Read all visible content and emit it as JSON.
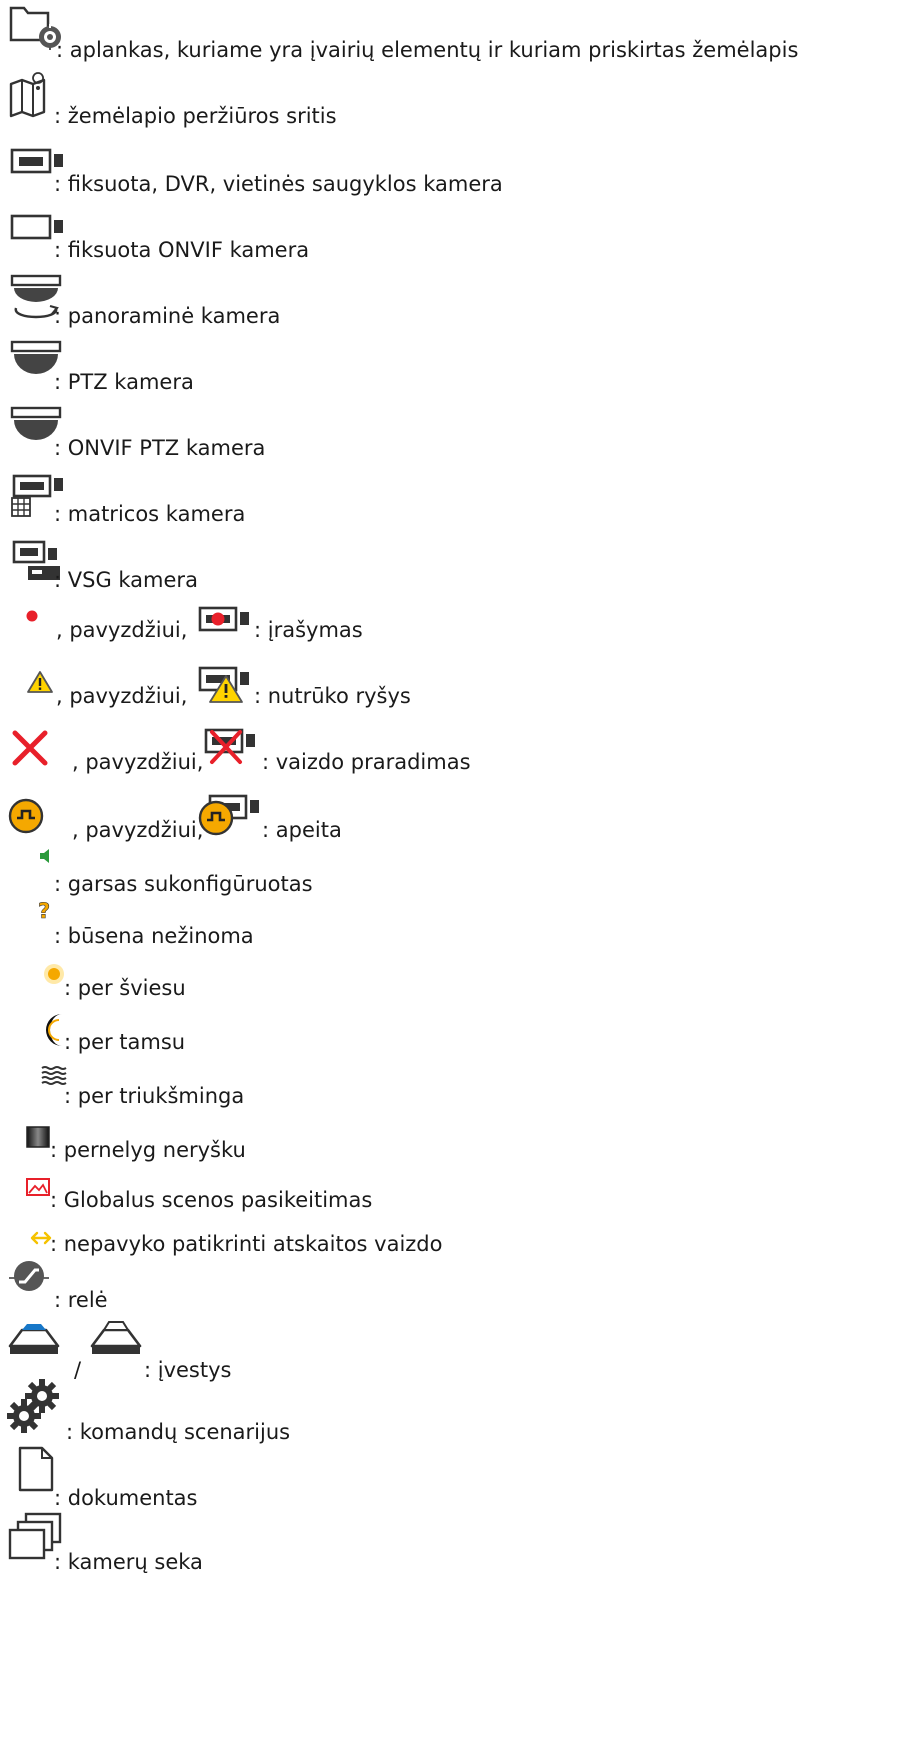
{
  "entries": [
    {
      "icon": "folder-with-map-icon",
      "text": ": aplankas, kuriame yra įvairių elementų ir kuriam priskirtas žemėlapis"
    },
    {
      "icon": "map-icon",
      "text": ": žemėlapio peržiūros sritis"
    },
    {
      "icon": "dvr-camera-icon",
      "text": ": fiksuota, DVR, vietinės saugyklos kamera"
    },
    {
      "icon": "onvif-camera-icon",
      "text": ": fiksuota ONVIF kamera"
    },
    {
      "icon": "panoramic-camera-icon",
      "text": ": panoraminė kamera"
    },
    {
      "icon": "ptz-camera-icon",
      "text": ": PTZ kamera"
    },
    {
      "icon": "onvif-ptz-camera-icon",
      "text": ": ONVIF PTZ kamera"
    },
    {
      "icon": "matrix-camera-icon",
      "text": ": matricos kamera"
    },
    {
      "icon": "vsg-camera-icon",
      "text": ": VSG kamera"
    },
    {
      "icon": "recording-dot-icon",
      "example_icon": "recording-camera-icon",
      "text_pre": ", pavyzdžiui,",
      "text": ": įrašymas"
    },
    {
      "icon": "warning-icon",
      "example_icon": "camera-warning-icon",
      "text_pre": ", pavyzdžiui,",
      "text": ": nutrūko ryšys"
    },
    {
      "icon": "red-x-icon",
      "example_icon": "camera-video-loss-icon",
      "text_pre": ", pavyzdžiui,",
      "text": ": vaizdo praradimas"
    },
    {
      "icon": "bypass-icon",
      "example_icon": "camera-bypass-icon",
      "text_pre": ", pavyzdžiui,",
      "text": ": apeita"
    },
    {
      "icon": "audio-icon",
      "text": ": garsas sukonfigūruotas"
    },
    {
      "icon": "question-mark-icon",
      "text": ": būsena nežinoma"
    },
    {
      "icon": "sun-icon",
      "text": ": per šviesu"
    },
    {
      "icon": "moon-icon",
      "text": ": per tamsu"
    },
    {
      "icon": "noise-icon",
      "text": ": per triukšminga"
    },
    {
      "icon": "blur-icon",
      "text": ": pernelyg neryšku"
    },
    {
      "icon": "scene-change-icon",
      "text": ": Globalus scenos pasikeitimas"
    },
    {
      "icon": "reference-check-icon",
      "text": ": nepavyko patikrinti atskaitos vaizdo"
    },
    {
      "icon": "relay-icon",
      "text": ": relė"
    },
    {
      "icon": "input-active-icon",
      "example_icon": "input-inactive-icon",
      "text_pre": "/",
      "text": ": įvestys"
    },
    {
      "icon": "gears-icon",
      "text": ": komandų scenarijus"
    },
    {
      "icon": "document-icon",
      "text": ": dokumentas"
    },
    {
      "icon": "camera-sequence-icon",
      "text": ": kamerų seka"
    }
  ],
  "colors": {
    "text": "#1a1a1a",
    "red": "#e8202a",
    "yellow": "#ffd400",
    "orange": "#f5a800",
    "green": "#2a9a3a",
    "blue": "#1777c8"
  }
}
